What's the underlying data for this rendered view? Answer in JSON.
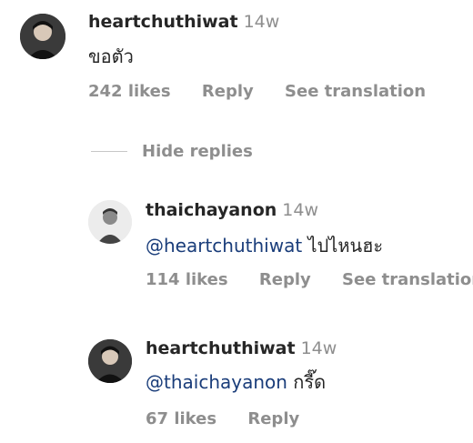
{
  "comment": {
    "username": "heartchuthiwat",
    "time": "14w",
    "text": "ขอตัว",
    "likes": "242 likes",
    "reply_label": "Reply",
    "translate_label": "See translation",
    "avatar_icon": "user-avatar-dark"
  },
  "hide_replies_label": "Hide replies",
  "replies": [
    {
      "username": "thaichayanon",
      "time": "14w",
      "mention": "@heartchuthiwat",
      "text": " ไปไหนฮะ",
      "likes": "114 likes",
      "reply_label": "Reply",
      "translate_label": "See translation",
      "avatar_icon": "user-avatar-light"
    },
    {
      "username": "heartchuthiwat",
      "time": "14w",
      "mention": "@thaichayanon",
      "text": " กรี๊ด",
      "likes": "67 likes",
      "reply_label": "Reply",
      "avatar_icon": "user-avatar-dark"
    }
  ]
}
